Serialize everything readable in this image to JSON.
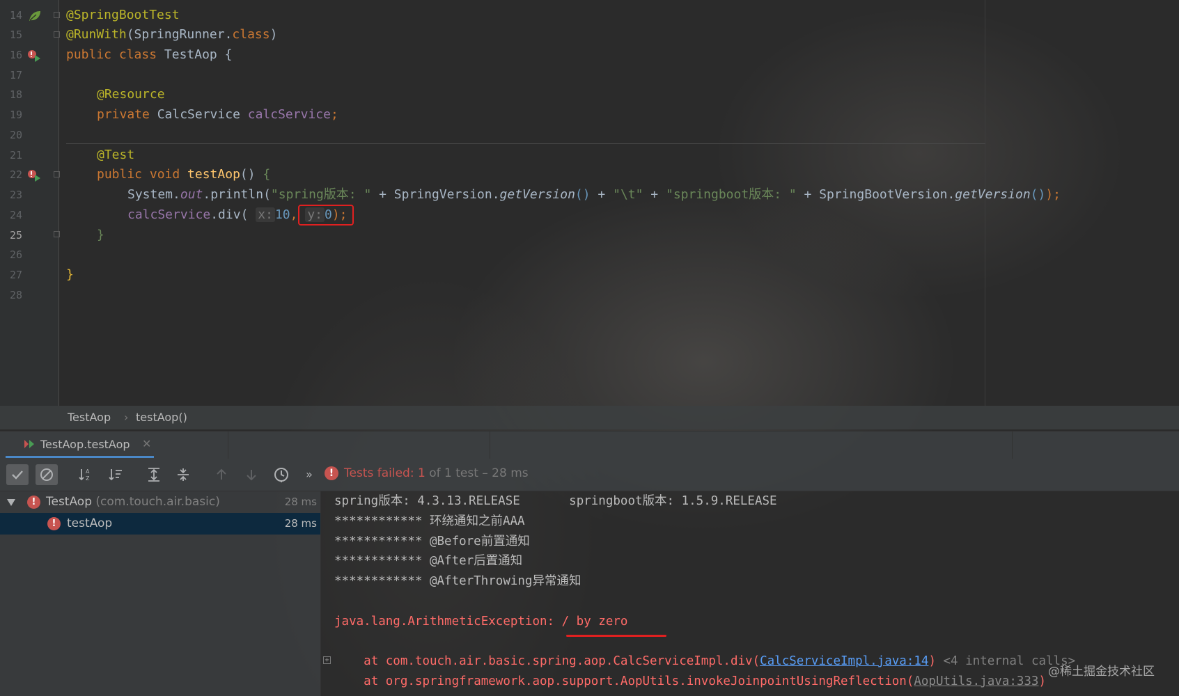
{
  "editor": {
    "line_numbers": [
      "14",
      "15",
      "16",
      "17",
      "18",
      "19",
      "20",
      "21",
      "22",
      "23",
      "24",
      "25",
      "26",
      "27",
      "28"
    ],
    "lines": {
      "l14": "@SpringBootTest",
      "l15_ann": "@RunWith",
      "l15_open": "(SpringRunner.",
      "l15_cls": "class",
      "l15_close": ")",
      "l16_kw": "public class ",
      "l16_name": "TestAop {",
      "l18": "@Resource",
      "l19_kw": "private ",
      "l19_type": "CalcService ",
      "l19_field": "calcService",
      "l19_semi": ";",
      "l21": "@Test",
      "l22_kw": "public void ",
      "l22_fn": "testAop",
      "l22_rest": "() ",
      "l22_brace": "{",
      "l23_sys": "System.",
      "l23_out": "out",
      "l23_println": ".println(",
      "l23_s1": "\"spring版本: \"",
      "l23_p1": " + SpringVersion.",
      "l23_gv1": "getVersion",
      "l23_pp1": "()",
      "l23_p2": " + ",
      "l23_s2": "\"\\t\"",
      "l23_p3": " + ",
      "l23_s3": "\"springboot版本: \"",
      "l23_p4": " + SpringBootVersion.",
      "l23_gv2": "getVersion",
      "l23_pp2": "()",
      "l23_end": ");",
      "l24_field": "calcService",
      "l24_call": ".div( ",
      "l24_hint_x": "x:",
      "l24_num_x": "10",
      "l24_comma": ", ",
      "l24_hint_y": "y:",
      "l24_num_y": "0",
      "l24_end": ");",
      "l25": "}",
      "l27": "}"
    }
  },
  "breadcrumb": {
    "class_name": "TestAop",
    "separator": "›",
    "method": "testAop()"
  },
  "run_tab": {
    "label": "TestAop.testAop",
    "close": "✕"
  },
  "toolbar": {
    "status_prefix": "Tests failed: ",
    "failed_count": "1",
    "status_suffix": " of 1 test – 28 ms",
    "more": "»"
  },
  "tree": [
    {
      "name": "TestAop",
      "package": " (com.touch.air.basic)",
      "time": "28 ms"
    },
    {
      "name": "testAop",
      "time": "28 ms"
    }
  ],
  "console": {
    "line1": "spring版本: 4.3.13.RELEASE\tspringboot版本: 1.5.9.RELEASE",
    "line2": "************ 环绕通知之前AAA",
    "line3": "************ @Before前置通知",
    "line4": "************ @After后置通知",
    "line5": "************ @AfterThrowing异常通知",
    "exception": "java.lang.ArithmeticException: / by zero",
    "trace1_pre": "\tat com.touch.air.basic.spring.aop.CalcServiceImpl.div(",
    "trace1_link": "CalcServiceImpl.java:14",
    "trace1_post": ")",
    "trace1_internal": " <4 internal calls>",
    "trace2_pre": "\tat org.springframework.aop.support.AopUtils.invokeJoinpointUsingReflection(",
    "trace2_link": "AopUtils.java:333",
    "trace2_post": ")"
  },
  "watermark": "@稀土掘金技术社区",
  "colors": {
    "annotation": "#bbb529",
    "keyword": "#cc7832",
    "string": "#6a8759",
    "field": "#9876aa",
    "method": "#ffc66d",
    "number": "#6897bb",
    "error": "#c75450",
    "highlight": "#e02020",
    "link": "#589df6",
    "selection": "#0d293e"
  },
  "icons": {
    "spring_bean": "leaf-icon",
    "run_gutter": "run-test-icon",
    "passed": "check-icon",
    "ignored": "ban-icon",
    "sort_alpha": "sort-alpha-icon",
    "sort_duration": "sort-duration-icon",
    "expand_all": "expand-all-icon",
    "collapse_all": "collapse-all-icon",
    "prev_failed": "arrow-up-icon",
    "next_failed": "arrow-down-icon",
    "history": "history-clock-icon",
    "error": "error-icon"
  }
}
